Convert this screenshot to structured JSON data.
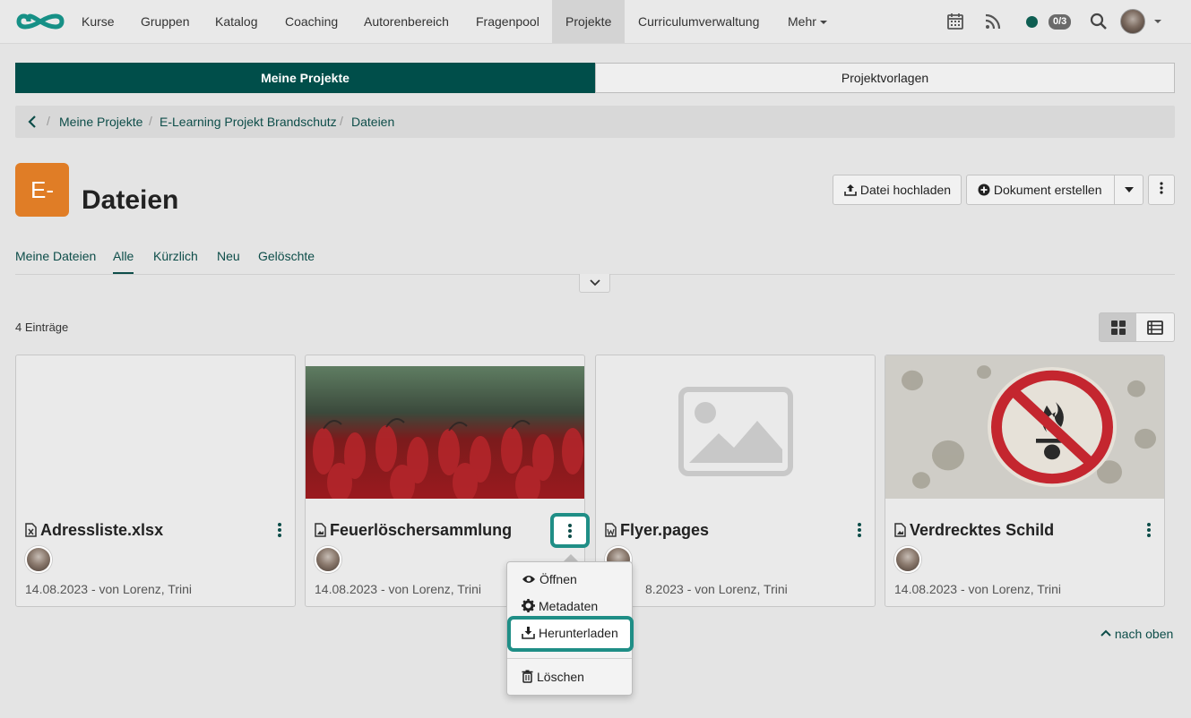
{
  "nav": {
    "items": [
      "Kurse",
      "Gruppen",
      "Katalog",
      "Coaching",
      "Autorenbereich",
      "Fragenpool",
      "Projekte",
      "Curriculumverwaltung"
    ],
    "more_label": "Mehr",
    "active": "Projekte",
    "badge": "0/3",
    "icons": [
      "calendar-icon",
      "rss-icon",
      "status-dot",
      "search-icon",
      "avatar"
    ]
  },
  "segments": {
    "mine": "Meine Projekte",
    "templates": "Projektvorlagen"
  },
  "breadcrumb": {
    "items": [
      "Meine Projekte",
      "E-Learning Projekt Brandschutz",
      "Dateien"
    ]
  },
  "header": {
    "project_abbr": "E-",
    "title": "Dateien",
    "upload_label": "Datei hochladen",
    "create_label": "Dokument erstellen"
  },
  "tabs": [
    "Meine Dateien",
    "Alle",
    "Kürzlich",
    "Neu",
    "Gelöschte"
  ],
  "tabs_active": "Alle",
  "count_label": "4 Einträge",
  "cards": [
    {
      "title": "Adressliste.xlsx",
      "meta": "14.08.2023 - von Lorenz, Trini",
      "icon": "excel-file-icon"
    },
    {
      "title": "Feuerlöschersammlung",
      "meta": "14.08.2023 - von Lorenz, Trini",
      "icon": "image-file-icon"
    },
    {
      "title": "Flyer.pages",
      "meta": "8.2023 - von Lorenz, Trini",
      "icon": "word-file-icon"
    },
    {
      "title": "Verdrecktes Schild",
      "meta": "14.08.2023 - von Lorenz, Trini",
      "icon": "image-file-icon"
    }
  ],
  "menu": {
    "open": "Öffnen",
    "metadata": "Metadaten",
    "download": "Herunterladen",
    "delete": "Löschen"
  },
  "to_top": "nach oben",
  "colors": {
    "brand": "#004e4a",
    "highlight": "#1f8e86",
    "project_icon": "#e07d26"
  }
}
